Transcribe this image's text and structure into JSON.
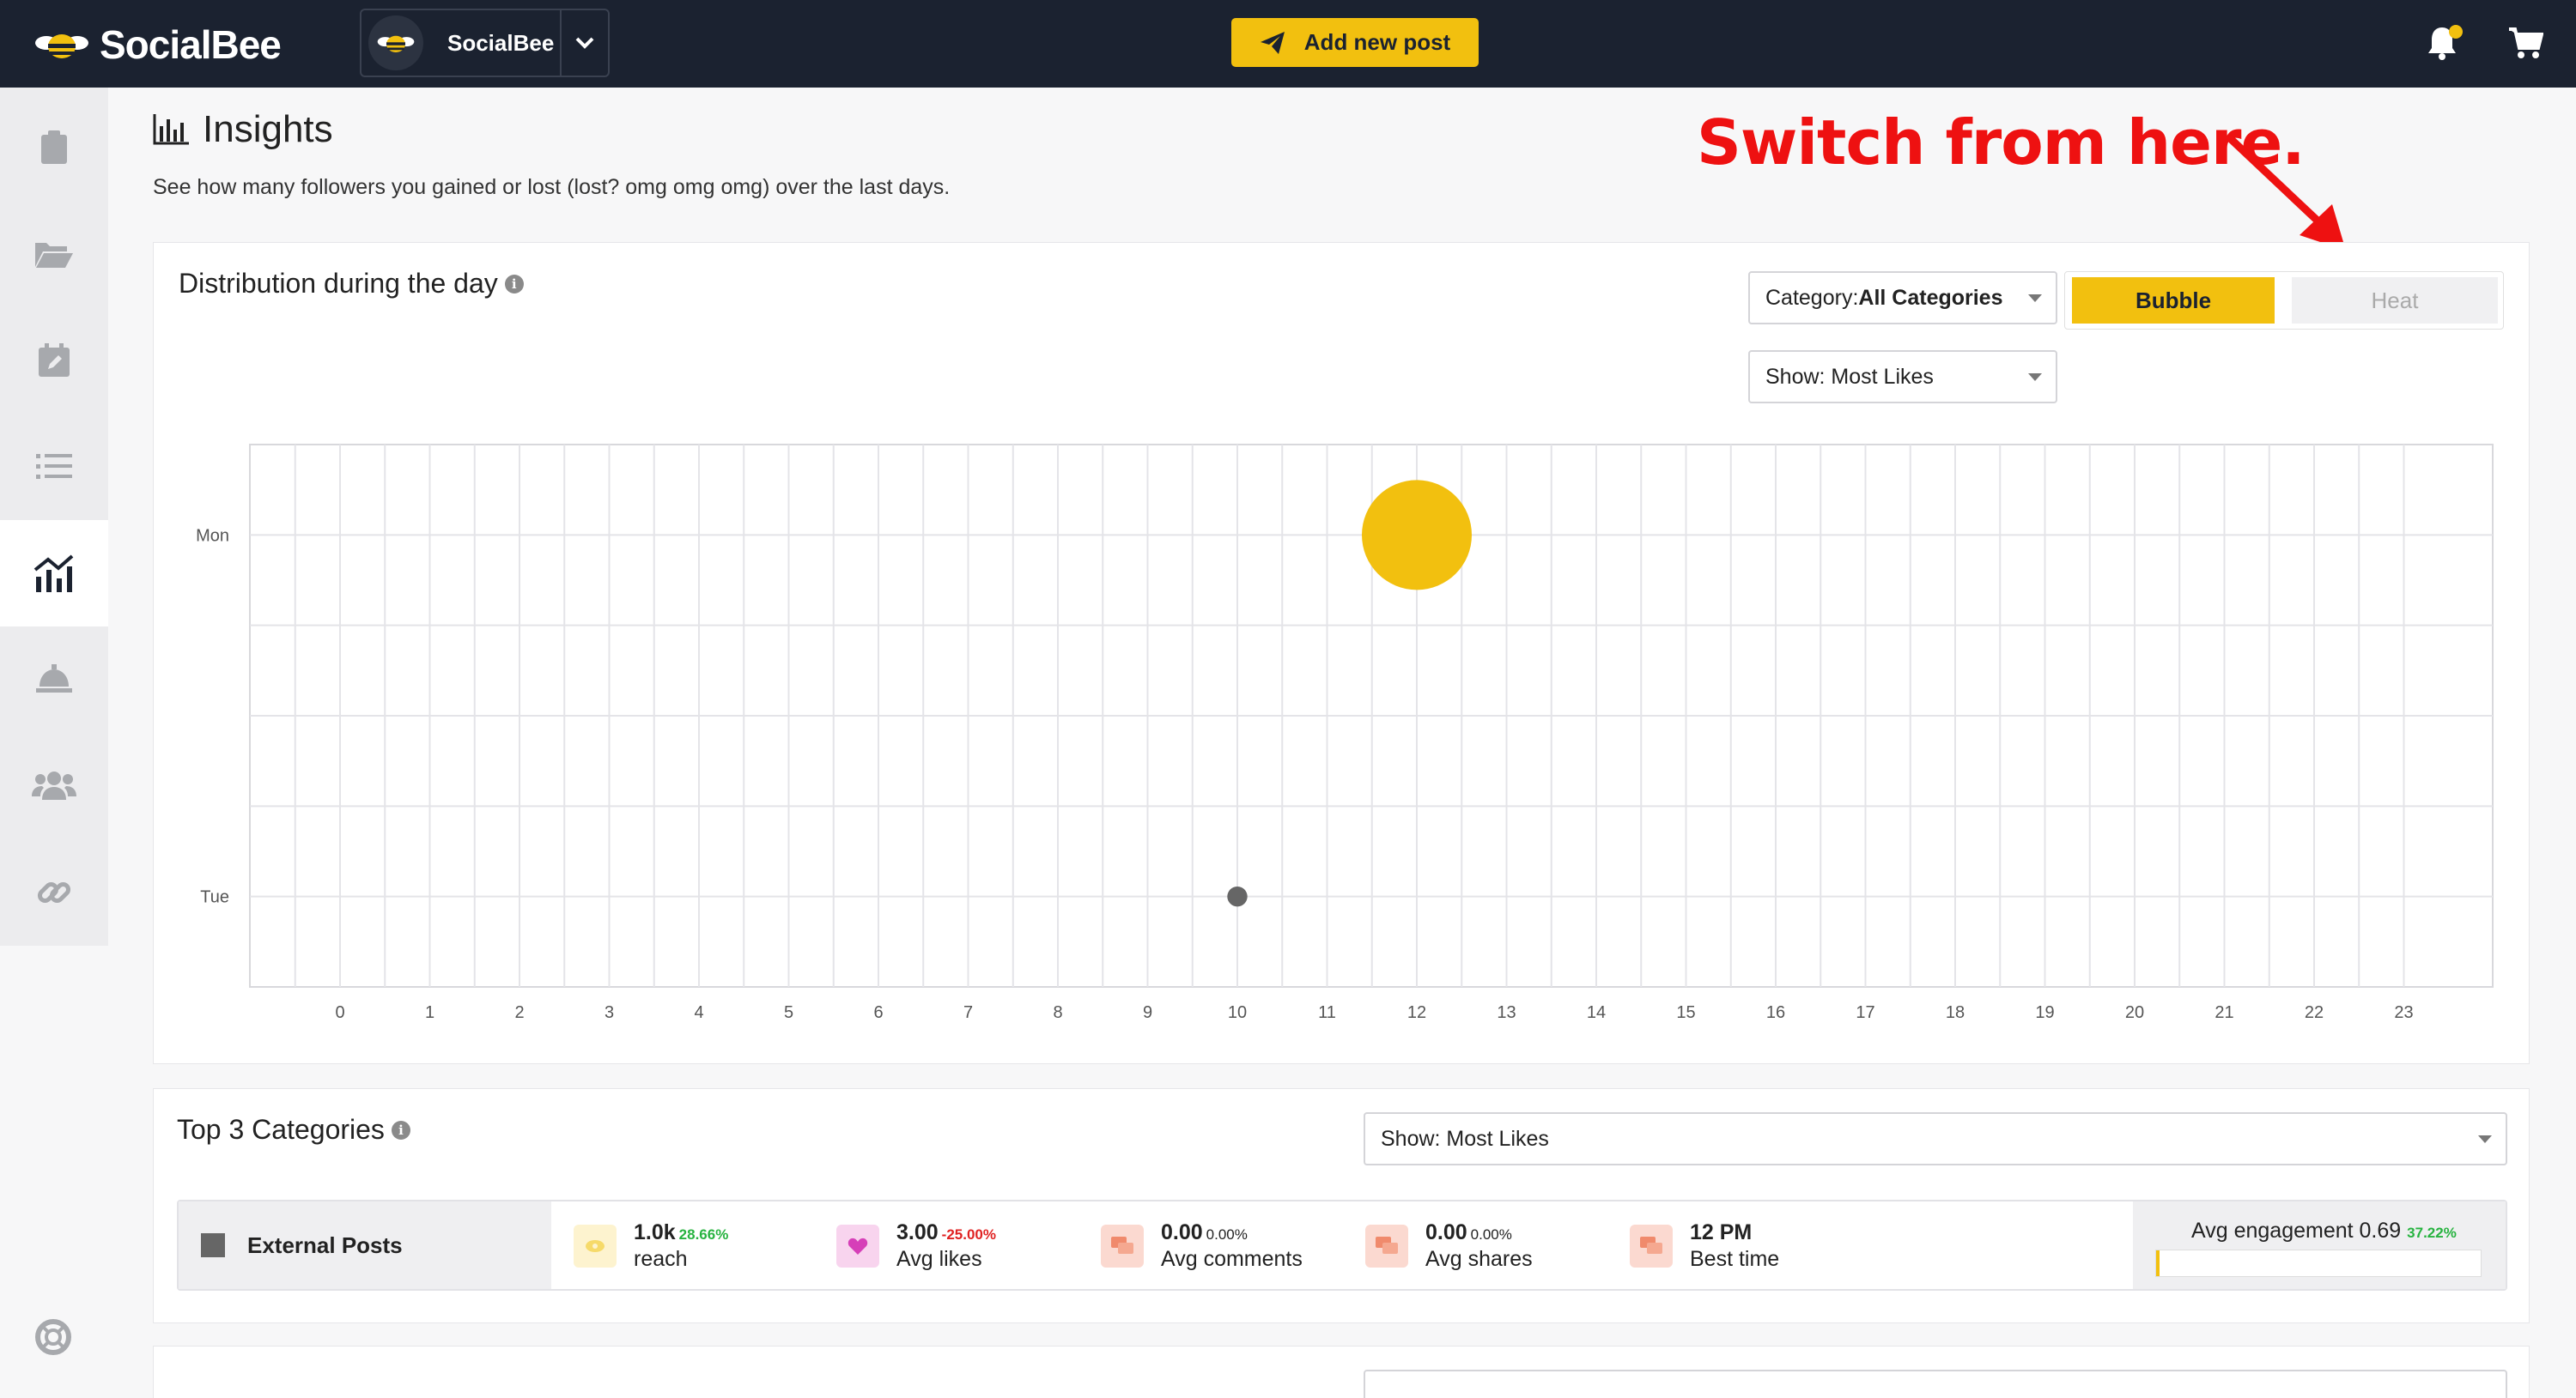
{
  "topbar": {
    "brand": "SocialBee",
    "account_name": "SocialBee",
    "add_post_label": "Add new post"
  },
  "header": {
    "title": "Insights",
    "subtitle": "See how many followers you gained or lost (lost? omg omg omg) over the last days."
  },
  "annotation": "Switch from here.",
  "distribution": {
    "title": "Distribution during the day",
    "category_select": "Category: ",
    "category_value": "All Categories",
    "show_select": "Show: Most Likes",
    "bubble_label": "Bubble",
    "heat_label": "Heat"
  },
  "chart_data": {
    "type": "scatter",
    "title": "Distribution during the day",
    "x_categories": [
      "0",
      "1",
      "2",
      "3",
      "4",
      "5",
      "6",
      "7",
      "8",
      "9",
      "10",
      "11",
      "12",
      "13",
      "14",
      "15",
      "16",
      "17",
      "18",
      "19",
      "20",
      "21",
      "22",
      "23"
    ],
    "y_categories": [
      "Mon",
      "",
      "",
      "",
      "Tue"
    ],
    "y_labels_shown": [
      "Mon",
      "Tue"
    ],
    "points": [
      {
        "x": 12,
        "y": "Mon",
        "size": 3.0,
        "color": "#f2c00f"
      },
      {
        "x": 10,
        "y": "Tue",
        "size": 0.1,
        "color": "#666666"
      }
    ],
    "grid": true,
    "legend": "none"
  },
  "top_categories": {
    "title": "Top 3 Categories",
    "show_select": "Show: Most Likes",
    "rows": [
      {
        "name": "External Posts",
        "reach_value": "1.0k",
        "reach_change": "28.66%",
        "reach_label": "reach",
        "likes_value": "3.00",
        "likes_change": "-25.00%",
        "likes_label": "Avg likes",
        "comments_value": "0.00",
        "comments_change": "0.00%",
        "comments_label": "Avg comments",
        "shares_value": "0.00",
        "shares_change": "0.00%",
        "shares_label": "Avg shares",
        "best_value": "12 PM",
        "best_label": "Best time",
        "engagement_label": "Avg engagement",
        "engagement_value": "0.69",
        "engagement_change": "37.22%",
        "engagement_fill_fraction": 0.01
      }
    ]
  },
  "colors": {
    "accent": "#f2c00f",
    "topbar": "#1b2230",
    "annotation": "#ee1111",
    "positive": "#27b340",
    "negative": "#e02222"
  }
}
